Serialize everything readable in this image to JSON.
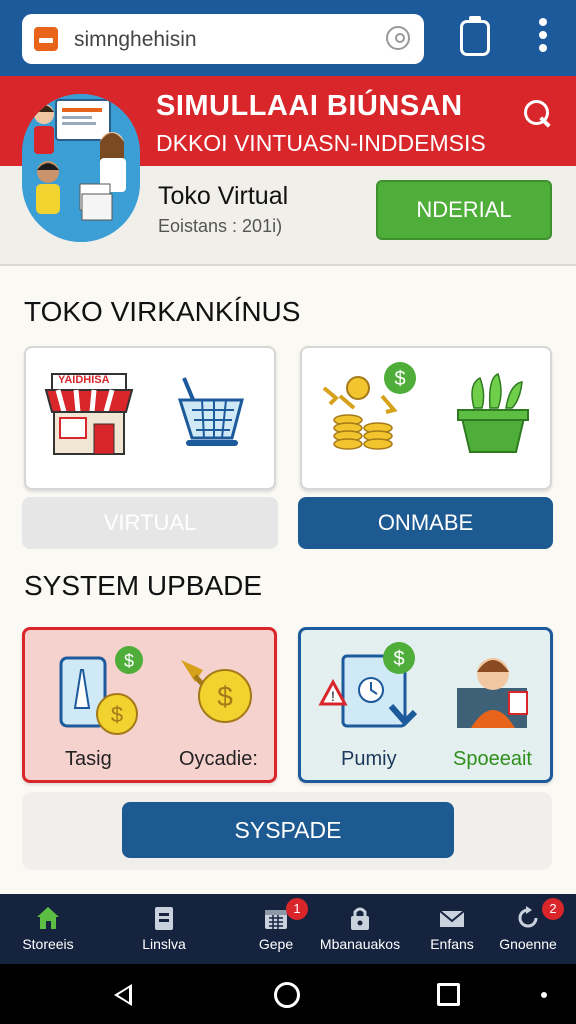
{
  "browser": {
    "url": "simnghehisin"
  },
  "banner": {
    "title": "SIMULLAAI BIÚNSAN",
    "subtitle": "DKKOI VINTUASN-INDDEMSIS",
    "store_name": "Toko Virtual",
    "store_meta": "Eoistans : 201i)",
    "primary_button": "NDERIAL"
  },
  "section1": {
    "title": "TOKO VIRKANKÍNUS",
    "card1": {
      "sign_text": "YAIDHISA"
    },
    "tab_left": "VIRTUAL",
    "tab_right": "ONMABE"
  },
  "section2": {
    "title": "SYSTEM UPBADE",
    "card_left": {
      "label_1": "Tasig",
      "label_2": "Oycadie:"
    },
    "card_right": {
      "label_1": "Pumiy",
      "label_2": "Spoeeait"
    },
    "button": "SYSPADE"
  },
  "bottom_nav": [
    {
      "label": "Storeeis",
      "icon": "store-icon"
    },
    {
      "label": "Linslva",
      "icon": "document-icon"
    },
    {
      "label": "Gepe",
      "icon": "calendar-icon",
      "badge": "1"
    },
    {
      "label": "Mbanauakos",
      "icon": "lock-bag-icon"
    },
    {
      "label": "Enfans",
      "icon": "mail-icon"
    },
    {
      "label": "Gnoenne",
      "icon": "refresh-icon",
      "badge": "2"
    }
  ],
  "colors": {
    "brand_blue": "#1d5a9c",
    "banner_red": "#d8262b",
    "accent_green": "#4fae3a",
    "nav_dark": "#16233f"
  }
}
